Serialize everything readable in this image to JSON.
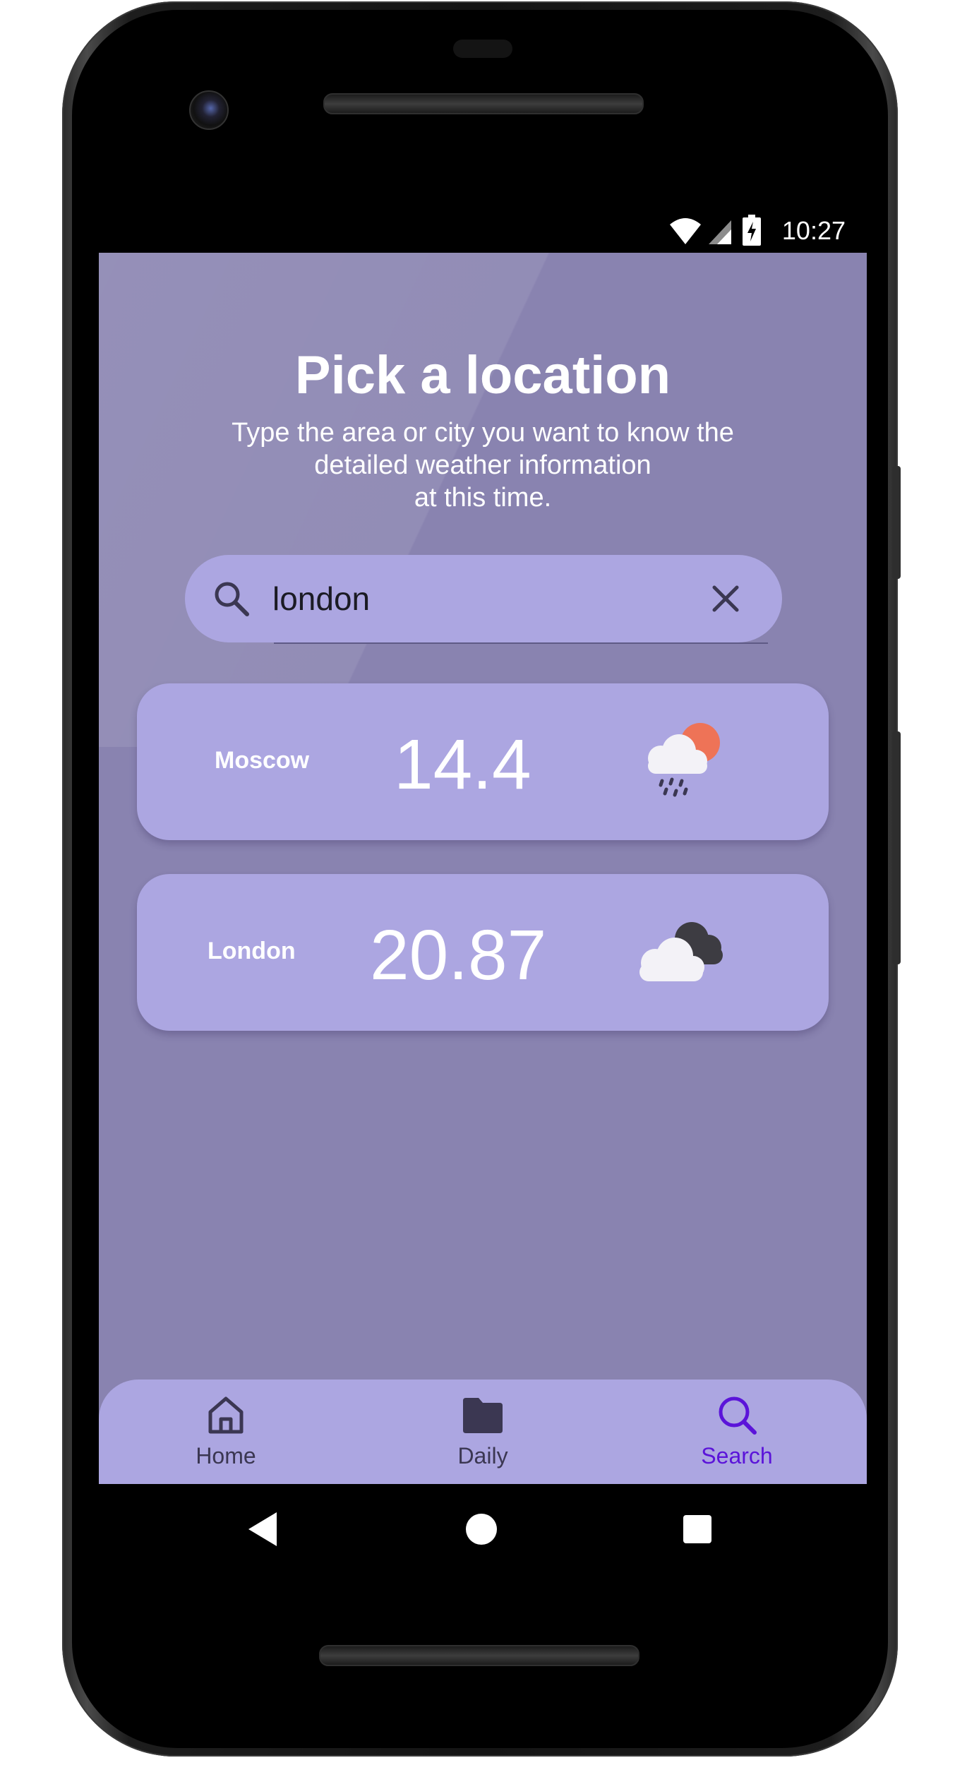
{
  "status_bar": {
    "time": "10:27",
    "icons": [
      "wifi-icon",
      "cell-signal-icon",
      "battery-charging-icon"
    ]
  },
  "header": {
    "title": "Pick a location",
    "subtitle_lines": [
      "Type the area or city you want to know the",
      "detailed weather information",
      "at this time."
    ]
  },
  "search": {
    "value": "london",
    "icon": "search-icon",
    "clear_icon": "close-icon"
  },
  "results": [
    {
      "city": "Moscow",
      "temperature": "14.4",
      "icon": "sun-cloud-rain-icon"
    },
    {
      "city": "London",
      "temperature": "20.87",
      "icon": "broken-clouds-icon"
    }
  ],
  "bottom_nav": {
    "items": [
      {
        "label": "Home",
        "icon": "home-icon",
        "active": false
      },
      {
        "label": "Daily",
        "icon": "folder-icon",
        "active": false
      },
      {
        "label": "Search",
        "icon": "search-icon",
        "active": true
      }
    ]
  },
  "colors": {
    "background": "#8983b0",
    "surface": "#aca6e1",
    "accent": "#5b14d9",
    "text": "#ffffff",
    "sun": "#ee7357"
  }
}
